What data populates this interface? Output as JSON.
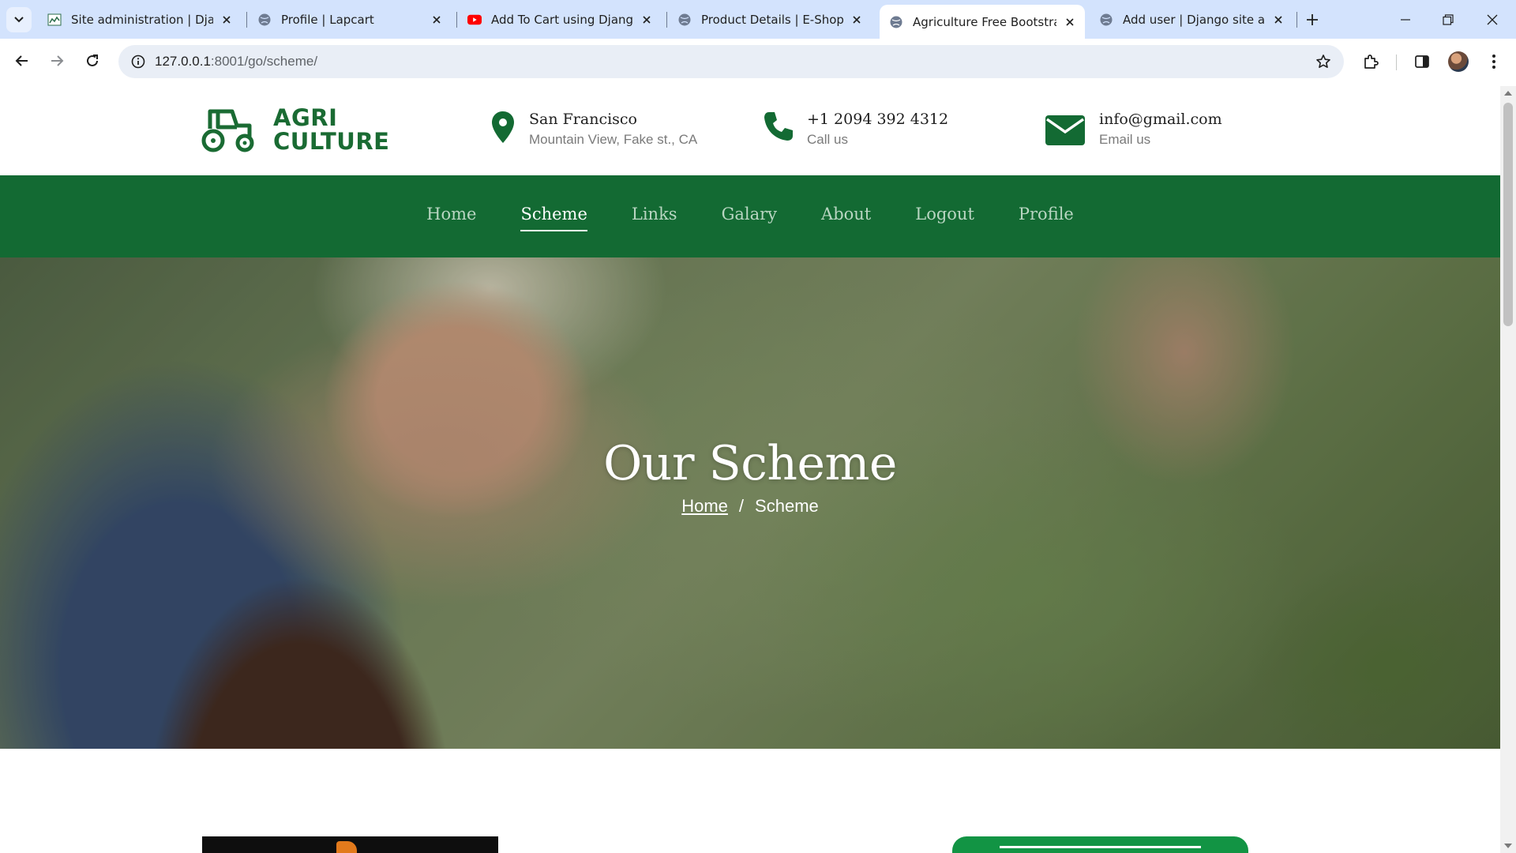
{
  "browser": {
    "tabs": [
      {
        "title": "Site administration | Django",
        "favicon": "django-admin-favicon",
        "active": false
      },
      {
        "title": "Profile | Lapcart",
        "favicon": "globe-icon",
        "active": false
      },
      {
        "title": "Add To Cart using Django",
        "favicon": "youtube-icon",
        "active": false
      },
      {
        "title": "Product Details | E-Shopper",
        "favicon": "globe-icon",
        "active": false
      },
      {
        "title": "Agriculture Free Bootstrap",
        "favicon": "globe-icon",
        "active": true
      },
      {
        "title": "Add user | Django site admin",
        "favicon": "globe-icon",
        "active": false
      }
    ],
    "url_host": "127.0.0.1",
    "url_rest": ":8001/go/scheme/"
  },
  "site": {
    "logo_line1": "AGRI",
    "logo_line2": "CULTURE",
    "location_title": "San Francisco",
    "location_sub": "Mountain View, Fake st., CA",
    "phone_title": "+1 2094 392 4312",
    "phone_sub": "Call us",
    "email_title": "info@gmail.com",
    "email_sub": "Email us",
    "brand_color": "#136a33",
    "nav": [
      "Home",
      "Scheme",
      "Links",
      "Galary",
      "About",
      "Logout",
      "Profile"
    ],
    "nav_active": "Scheme"
  },
  "hero": {
    "title": "Our Scheme",
    "breadcrumb_home": "Home",
    "breadcrumb_sep": "/",
    "breadcrumb_current": "Scheme"
  }
}
